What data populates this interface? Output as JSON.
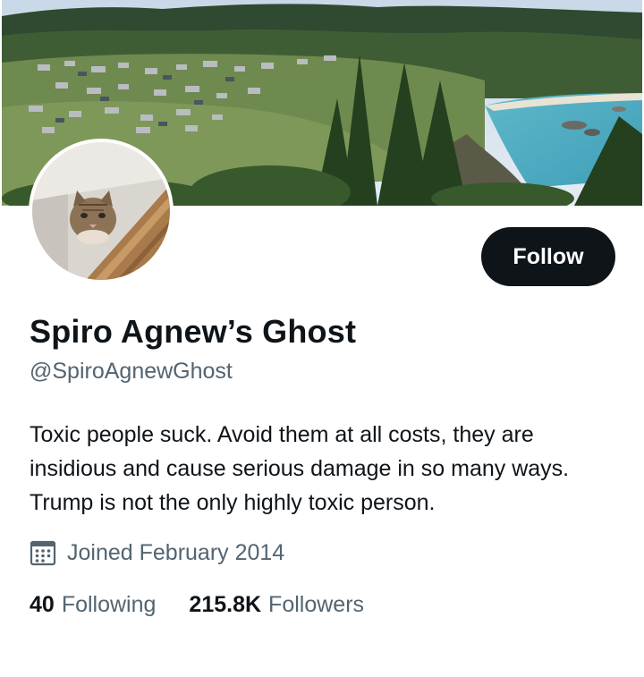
{
  "profile": {
    "display_name": "Spiro Agnew’s Ghost",
    "handle": "@SpiroAgnewGhost",
    "bio": "Toxic people suck. Avoid them at all costs, they are insidious and cause serious damage in so many ways. Trump is not the only highly toxic person.",
    "joined": "Joined February 2014"
  },
  "actions": {
    "follow_label": "Follow"
  },
  "stats": {
    "following_count": "40",
    "following_label": "Following",
    "followers_count": "215.8K",
    "followers_label": "Followers"
  },
  "icons": {
    "joined": "calendar-icon"
  },
  "colors": {
    "text_primary": "#0f1419",
    "text_secondary": "#536471",
    "button_bg": "#0f1419",
    "button_text": "#ffffff"
  }
}
